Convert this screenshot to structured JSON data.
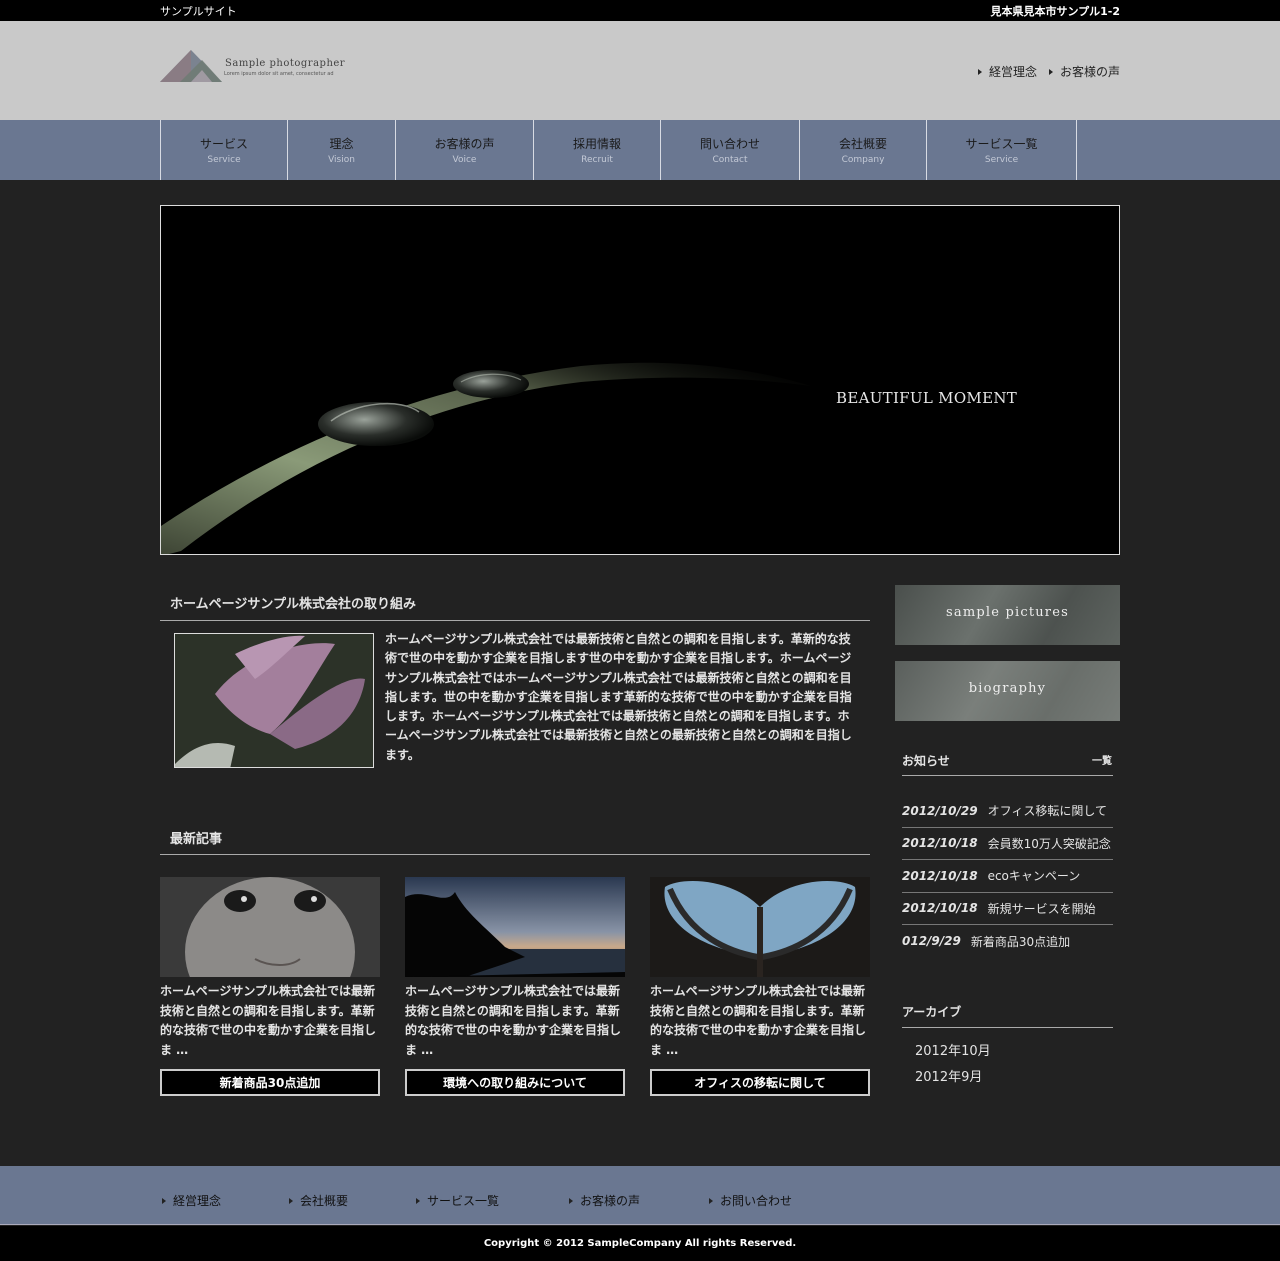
{
  "topbar": {
    "site_name": "サンプルサイト",
    "address": "見本県見本市サンプル1-2"
  },
  "logo": {
    "name": "Sample photographer",
    "tagline": "Lorem ipsum dolor sit amet, consectetur ad"
  },
  "header_links": [
    {
      "label": "経営理念"
    },
    {
      "label": "お客様の声"
    }
  ],
  "nav": [
    {
      "ja": "サービス",
      "en": "Service"
    },
    {
      "ja": "理念",
      "en": "Vision"
    },
    {
      "ja": "お客様の声",
      "en": "Voice"
    },
    {
      "ja": "採用情報",
      "en": "Recruit"
    },
    {
      "ja": "問い合わせ",
      "en": "Contact"
    },
    {
      "ja": "会社概要",
      "en": "Company"
    },
    {
      "ja": "サービス一覧",
      "en": "Service"
    }
  ],
  "hero": {
    "caption": "BEAUTIFUL MOMENT"
  },
  "intro": {
    "title": "ホームページサンプル株式会社の取り組み",
    "text": "ホームページサンプル株式会社では最新技術と自然との調和を目指します。革新的な技術で世の中を動かす企業を目指します世の中を動かす企業を目指します。ホームページサンプル株式会社ではホームページサンプル株式会社では最新技術と自然との調和を目指します。世の中を動かす企業を目指します革新的な技術で世の中を動かす企業を目指します。ホームページサンプル株式会社では最新技術と自然との調和を目指します。ホームページサンプル株式会社では最新技術と自然との最新技術と自然との調和を目指します。"
  },
  "latest": {
    "title": "最新記事",
    "cards": [
      {
        "desc": "ホームページサンプル株式会社では最新技術と自然との調和を目指します。革新的な技術で世の中を動かす企業を目指しま …",
        "button": "新着商品30点追加"
      },
      {
        "desc": "ホームページサンプル株式会社では最新技術と自然との調和を目指します。革新的な技術で世の中を動かす企業を目指しま …",
        "button": "環境への取り組みについて"
      },
      {
        "desc": "ホームページサンプル株式会社では最新技術と自然との調和を目指します。革新的な技術で世の中を動かす企業を目指しま …",
        "button": "オフィスの移転に関して"
      }
    ]
  },
  "sidebar": {
    "banners": [
      {
        "label": "sample pictures"
      },
      {
        "label": "biography"
      }
    ],
    "news_title": "お知らせ",
    "news_more": "一覧",
    "news": [
      {
        "date": "2012/10/29",
        "title": "オフィス移転に関して"
      },
      {
        "date": "2012/10/18",
        "title": "会員数10万人突破記念"
      },
      {
        "date": "2012/10/18",
        "title": "ecoキャンペーン"
      },
      {
        "date": "2012/10/18",
        "title": "新規サービスを開始"
      },
      {
        "date": "012/9/29",
        "title": "新着商品30点追加"
      }
    ],
    "archive_title": "アーカイブ",
    "archive": [
      {
        "label": "2012年10月"
      },
      {
        "label": "2012年9月"
      }
    ]
  },
  "footer": {
    "links": [
      {
        "label": "経営理念"
      },
      {
        "label": "会社概要"
      },
      {
        "label": "サービス一覧"
      },
      {
        "label": "お客様の声"
      },
      {
        "label": "お問い合わせ"
      }
    ],
    "copyright": "Copyright © 2012 SampleCompany All rights Reserved."
  },
  "colors": {
    "nav_bg": "#6a7791",
    "header_bg": "#c9c9c9",
    "body_bg": "#222222"
  }
}
